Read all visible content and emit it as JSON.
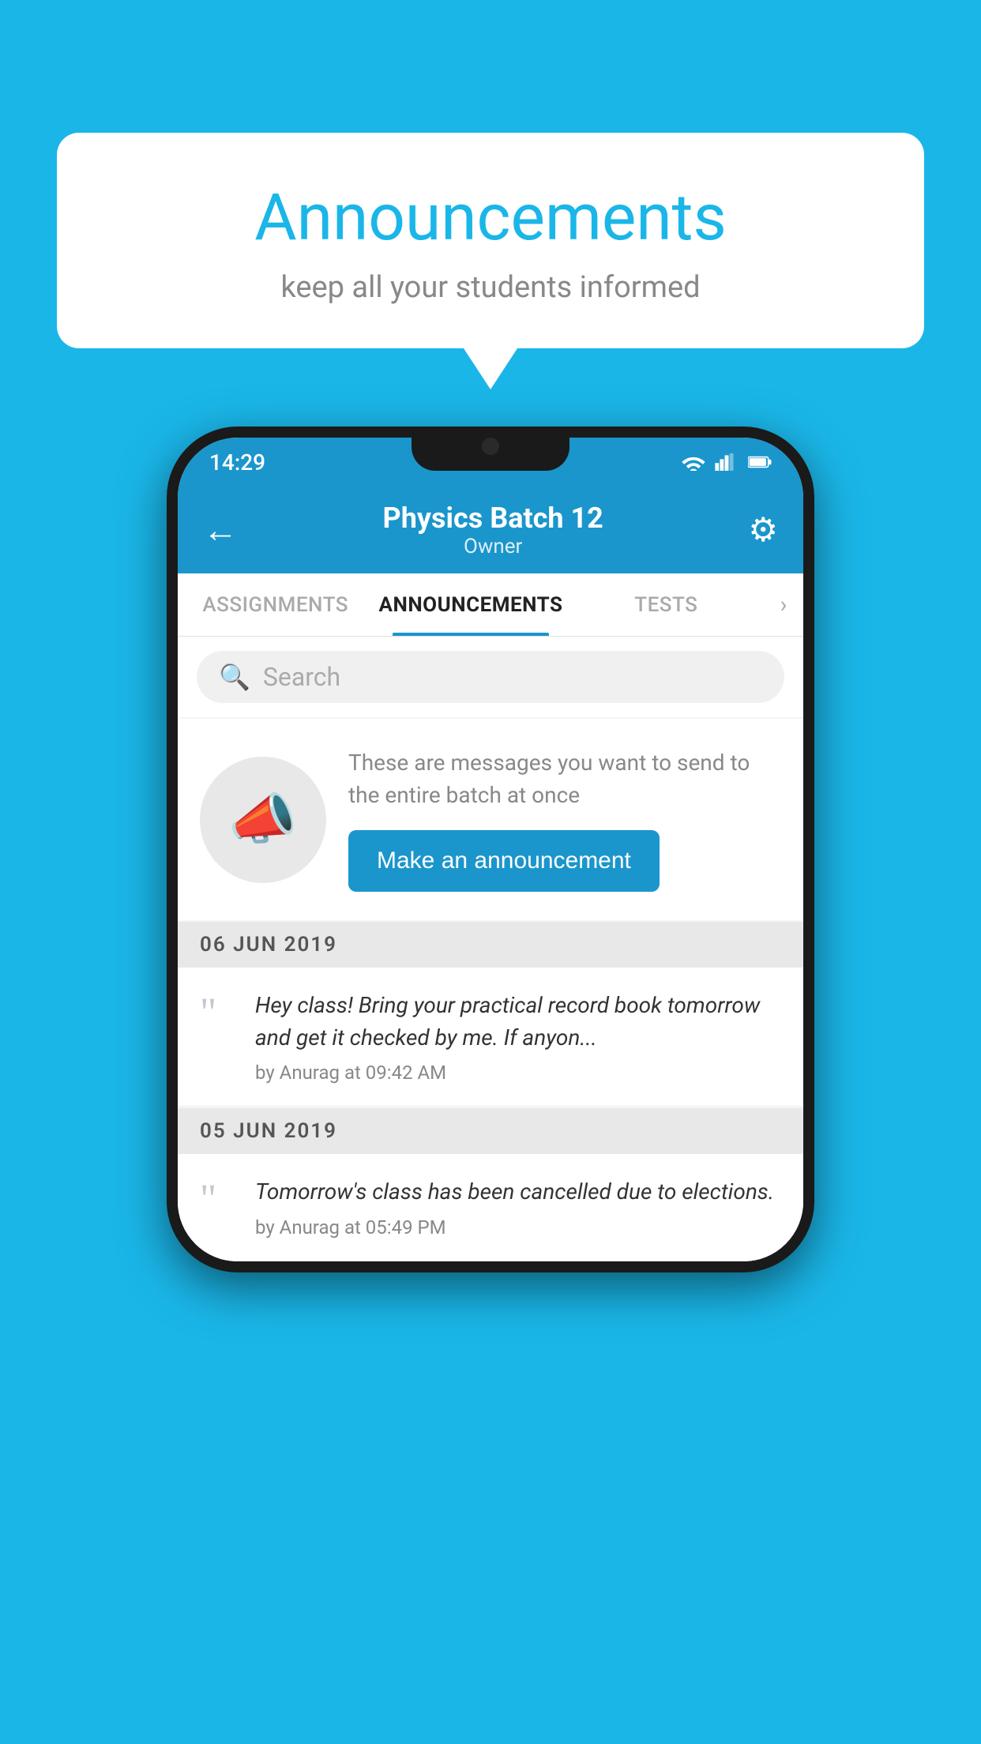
{
  "page": {
    "background_color": "#1ab6e8"
  },
  "speech_bubble": {
    "title": "Announcements",
    "subtitle": "keep all your students informed"
  },
  "status_bar": {
    "time": "14:29"
  },
  "top_bar": {
    "title": "Physics Batch 12",
    "subtitle": "Owner",
    "back_label": "←",
    "gear_label": "⚙"
  },
  "tabs": [
    {
      "label": "ASSIGNMENTS",
      "active": false
    },
    {
      "label": "ANNOUNCEMENTS",
      "active": true
    },
    {
      "label": "TESTS",
      "active": false
    }
  ],
  "search": {
    "placeholder": "Search"
  },
  "promo": {
    "description": "These are messages you want to send to the entire batch at once",
    "button_label": "Make an announcement"
  },
  "announcements": [
    {
      "date": "06  JUN  2019",
      "text": "Hey class! Bring your practical record book tomorrow and get it checked by me. If anyon...",
      "meta": "by Anurag at 09:42 AM"
    },
    {
      "date": "05  JUN  2019",
      "text": "Tomorrow's class has been cancelled due to elections.",
      "meta": "by Anurag at 05:49 PM"
    }
  ]
}
